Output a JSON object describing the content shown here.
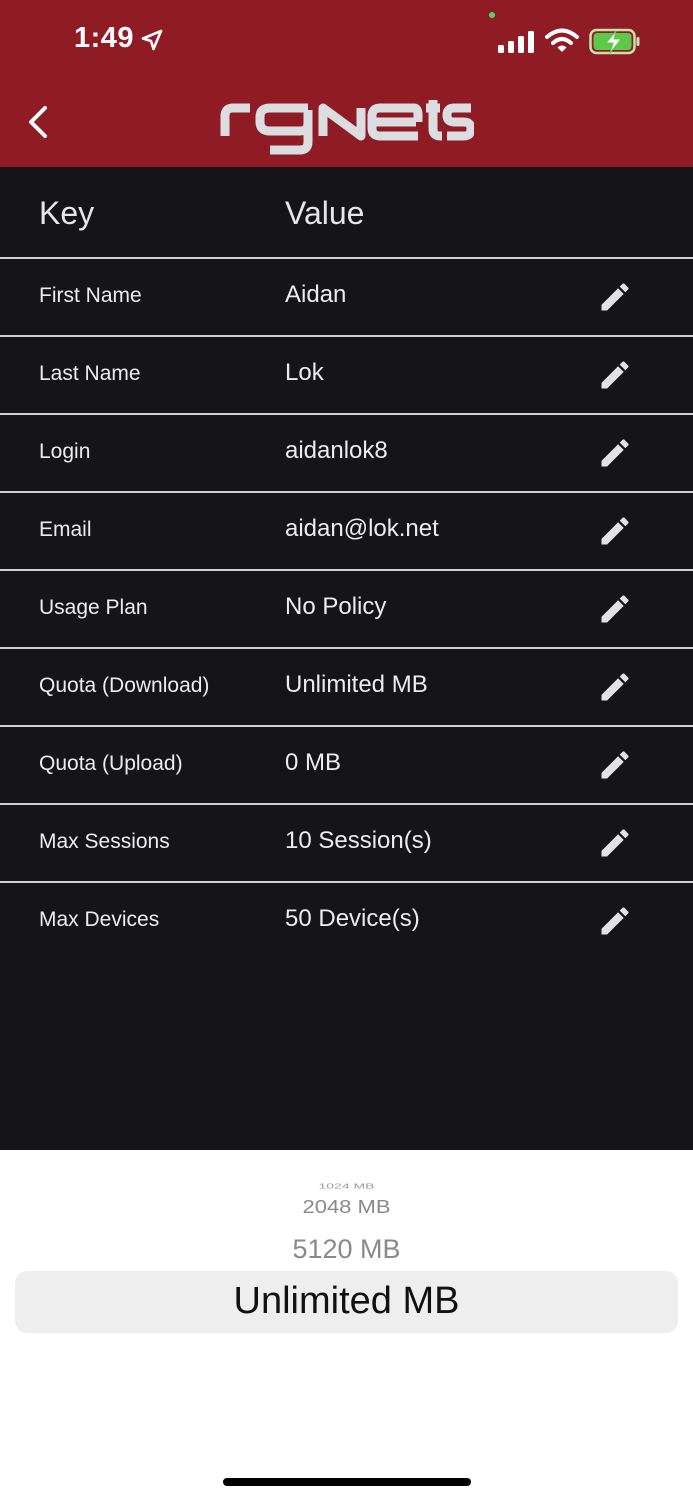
{
  "status_bar": {
    "time": "1:49"
  },
  "header": {
    "logo": "rgNets",
    "back_icon": "chevron-left-icon"
  },
  "table": {
    "key_header": "Key",
    "value_header": "Value",
    "rows": [
      {
        "key": "First Name",
        "value": "Aidan"
      },
      {
        "key": "Last Name",
        "value": "Lok"
      },
      {
        "key": "Login",
        "value": "aidanlok8"
      },
      {
        "key": "Email",
        "value": "aidan@lok.net"
      },
      {
        "key": "Usage Plan",
        "value": "No Policy"
      },
      {
        "key": "Quota (Download)",
        "value": "Unlimited MB"
      },
      {
        "key": "Quota (Upload)",
        "value": "0 MB"
      },
      {
        "key": "Max Sessions",
        "value": "10 Session(s)"
      },
      {
        "key": "Max Devices",
        "value": "50 Device(s)"
      }
    ]
  },
  "picker": {
    "options": [
      "1024 MB",
      "2048 MB",
      "5120 MB"
    ],
    "selected": "Unlimited MB"
  },
  "colors": {
    "header_bg": "#8f1b25",
    "body_bg": "#141419",
    "picker_bg": "#ffffff"
  }
}
